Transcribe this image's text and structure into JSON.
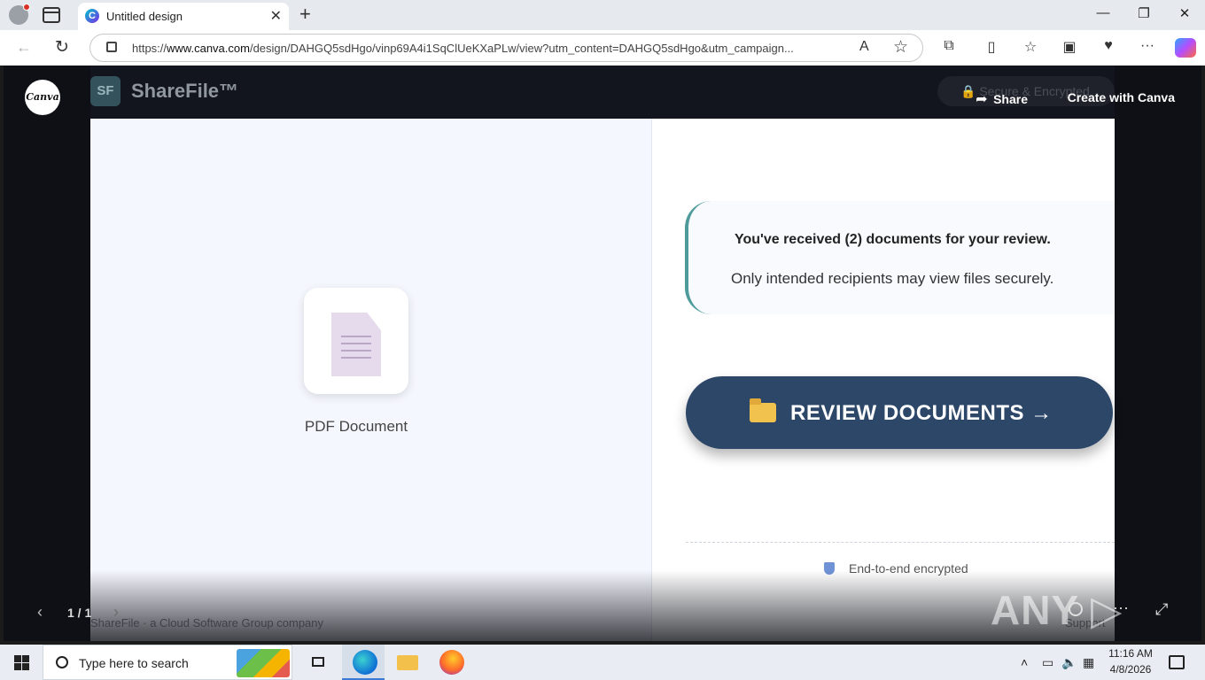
{
  "browser": {
    "tab_title": "Untitled design",
    "tab_favicon": "C",
    "url_prefix": "https://",
    "url_domain": "www.canva.com",
    "url_rest": "/design/DAHGQ5sdHgo/vinp69A4i1SqClUeKXaPLw/view?utm_content=DAHGQ5sdHgo&utm_campaign...",
    "read_aloud": "A",
    "favorite": "☆",
    "icons": [
      "profile-icon",
      "tab-actions-icon",
      "close-icon",
      "new-tab-icon",
      "minimize-icon",
      "restore-icon",
      "window-close-icon",
      "back-icon",
      "reload-icon",
      "lock-icon",
      "read-aloud-icon",
      "favorite-icon",
      "extensions-icon",
      "split-screen-icon",
      "favorites-icon",
      "collections-icon",
      "performance-icon",
      "more-icon",
      "copilot-icon"
    ]
  },
  "viewer": {
    "canva_logo": "Canva",
    "share_label": "Share",
    "create_label": "Create with Canva",
    "pager": "1 / 1",
    "watermark": "ANY ▷ RUN"
  },
  "design": {
    "header": {
      "logo_text": "SF",
      "brand": "ShareFile™",
      "secure_label": "🔒 Secure & Encrypted"
    },
    "document_label": "PDF Document",
    "notice": {
      "main": "You've received (2) documents for your review.",
      "sub": "Only intended recipients may view files securely."
    },
    "review_button": "REVIEW DOCUMENTS →",
    "encrypted_label": "End-to-end encrypted",
    "footer": "ShareFile · a Cloud Software Group company",
    "footer_right": "Support"
  },
  "taskbar": {
    "search_placeholder": "Type here to search",
    "time": "11:16 AM",
    "date": "4/8/2026"
  },
  "colors": {
    "review_button": "#2d4769",
    "notice_accent": "#4f9a9b",
    "left_pane": "#f4f7fd",
    "viewer_bg": "#0e1016"
  }
}
